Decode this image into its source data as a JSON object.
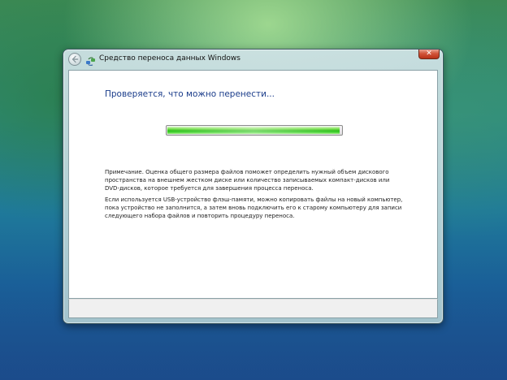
{
  "window": {
    "title": "Средство переноса данных Windows",
    "close_label": "✕"
  },
  "icons": {
    "back": "back-arrow-icon",
    "app": "transfer-icon",
    "close": "close-icon"
  },
  "main": {
    "heading": "Проверяется, что можно перенести...",
    "progress_fraction": 0.99,
    "note": "Примечание. Оценка общего размера файлов поможет определить нужный объем дискового пространства на внешнем жестком диске или количество записываемых компакт-дисков или DVD-дисков, которое требуется для завершения процесса переноса.",
    "usb_note": "Если используется USB-устройство флэш-памяти, можно копировать файлы на новый компьютер, пока устройство не заполнится, а затем вновь подключить его к старому компьютеру для записи следующего набора файлов и повторить процедуру переноса."
  },
  "colors": {
    "heading": "#1a3c8a",
    "progress": "#2fbf1c",
    "close": "#d2553a"
  }
}
